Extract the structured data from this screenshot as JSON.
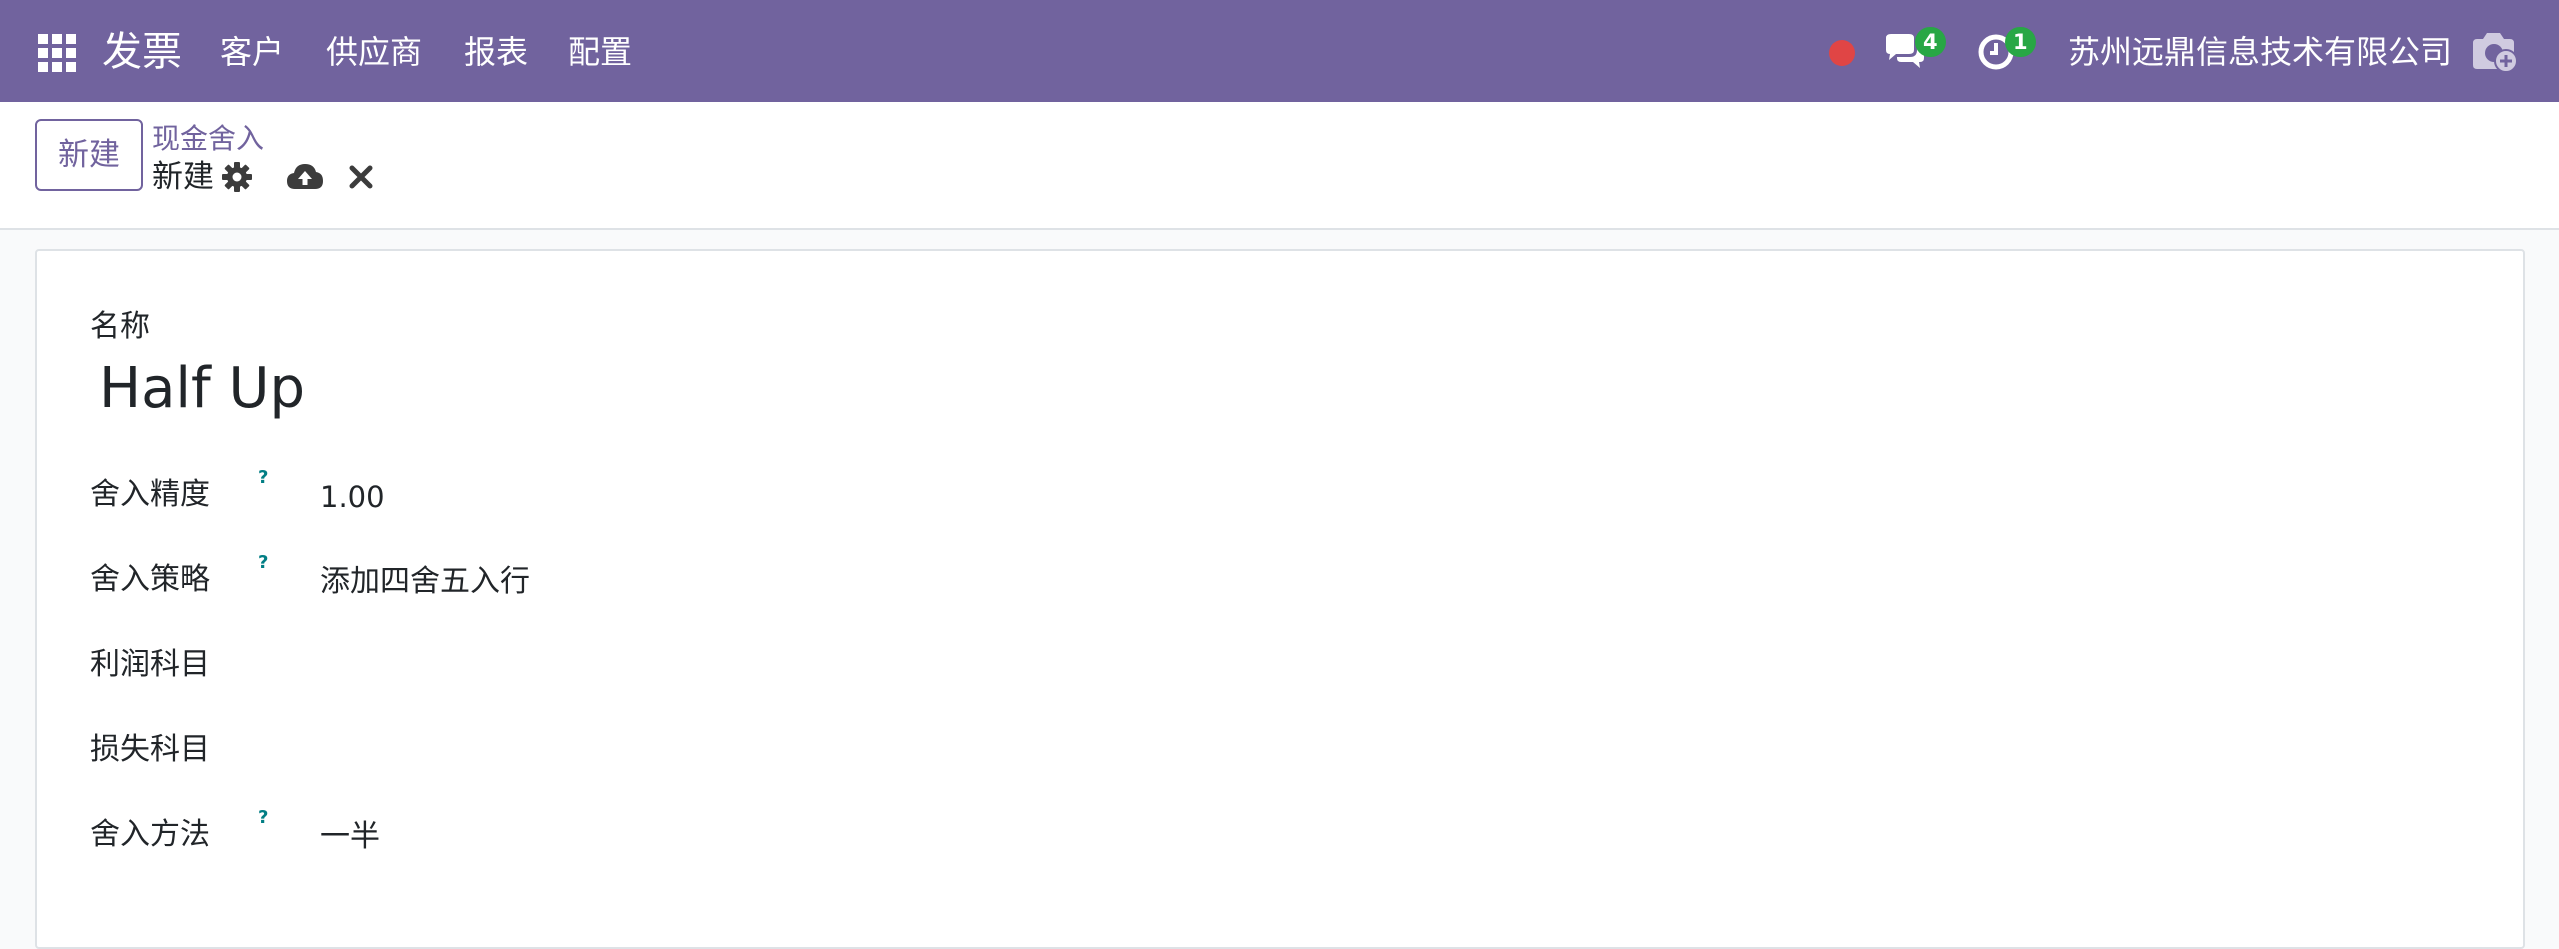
{
  "navbar": {
    "app_name": "发票",
    "menu": [
      "客户",
      "供应商",
      "报表",
      "配置"
    ],
    "messages_count": "4",
    "activities_count": "1",
    "company": "苏州远鼎信息技术有限公司",
    "colors": {
      "bar": "#71639e",
      "badge": "#28a745",
      "record_dot": "#e04545"
    }
  },
  "control_panel": {
    "new_button": "新建",
    "breadcrumb_parent": "现金舍入",
    "breadcrumb_current": "新建"
  },
  "form": {
    "name_label": "名称",
    "name_value": "Half Up",
    "fields": [
      {
        "label": "舍入精度",
        "help": "?",
        "value": "1.00"
      },
      {
        "label": "舍入策略",
        "help": "?",
        "value": "添加四舍五入行"
      },
      {
        "label": "利润科目",
        "value": ""
      },
      {
        "label": "损失科目",
        "value": ""
      },
      {
        "label": "舍入方法",
        "help": "?",
        "value": "一半"
      }
    ]
  }
}
